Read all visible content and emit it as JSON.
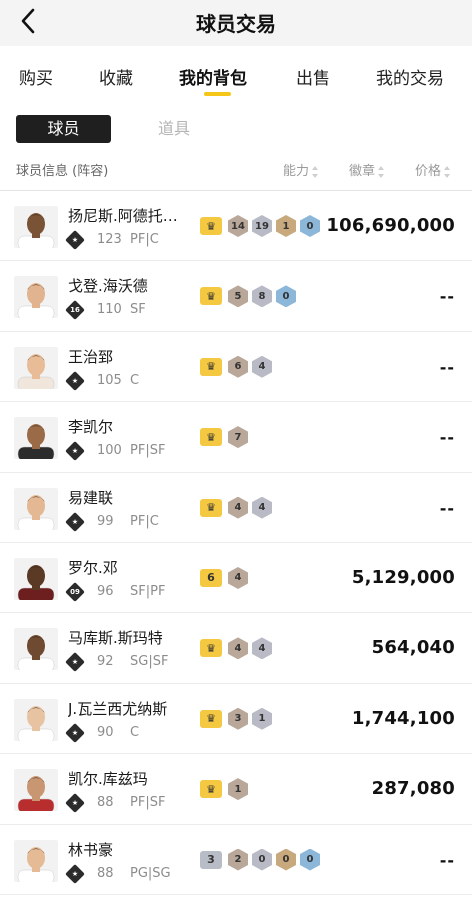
{
  "header": {
    "title": "球员交易"
  },
  "tabs": [
    {
      "label": "购买"
    },
    {
      "label": "收藏"
    },
    {
      "label": "我的背包"
    },
    {
      "label": "出售"
    },
    {
      "label": "我的交易"
    }
  ],
  "segments": {
    "players": "球员",
    "items": "道具"
  },
  "columns": {
    "info": "球员信息 (阵容)",
    "ability": "能力",
    "badge": "徽章",
    "price": "价格"
  },
  "players": [
    {
      "name": "扬尼斯.阿德托…",
      "tier": "",
      "rating": "123",
      "pos": "PF|C",
      "crown": "",
      "badges": [
        "14",
        "19",
        "1",
        "0"
      ],
      "price": "106,690,000"
    },
    {
      "name": "戈登.海沃德",
      "tier": "16",
      "rating": "110",
      "pos": "SF",
      "crown": "",
      "badges": [
        "5",
        "8",
        "0"
      ],
      "price": "--"
    },
    {
      "name": "王治郅",
      "tier": "",
      "rating": "105",
      "pos": "C",
      "crown": "",
      "badges": [
        "6",
        "4"
      ],
      "price": "--"
    },
    {
      "name": "李凯尔",
      "tier": "",
      "rating": "100",
      "pos": "PF|SF",
      "crown": "",
      "badges": [
        "7"
      ],
      "price": "--"
    },
    {
      "name": "易建联",
      "tier": "",
      "rating": "99",
      "pos": "PF|C",
      "crown": "",
      "badges": [
        "4",
        "4"
      ],
      "price": "--"
    },
    {
      "name": "罗尔.邓",
      "tier": "09",
      "rating": "96",
      "pos": "SF|PF",
      "crown": "6",
      "badges": [
        "4"
      ],
      "price": "5,129,000"
    },
    {
      "name": "马库斯.斯玛特",
      "tier": "",
      "rating": "92",
      "pos": "SG|SF",
      "crown": "",
      "badges": [
        "4",
        "4"
      ],
      "price": "564,040"
    },
    {
      "name": "J.瓦兰西尤纳斯",
      "tier": "",
      "rating": "90",
      "pos": "C",
      "crown": "",
      "badges": [
        "3",
        "1"
      ],
      "price": "1,744,100"
    },
    {
      "name": "凯尔.库兹玛",
      "tier": "",
      "rating": "88",
      "pos": "PF|SF",
      "crown": "",
      "badges": [
        "1"
      ],
      "price": "287,080"
    },
    {
      "name": "林书豪",
      "tier": "",
      "rating": "88",
      "pos": "PG|SG",
      "crown": "3",
      "badges": [
        "2",
        "0",
        "0",
        "0"
      ],
      "price": "--"
    }
  ],
  "colors": {
    "accent": "#f5c518",
    "crown": "#f5c842"
  }
}
